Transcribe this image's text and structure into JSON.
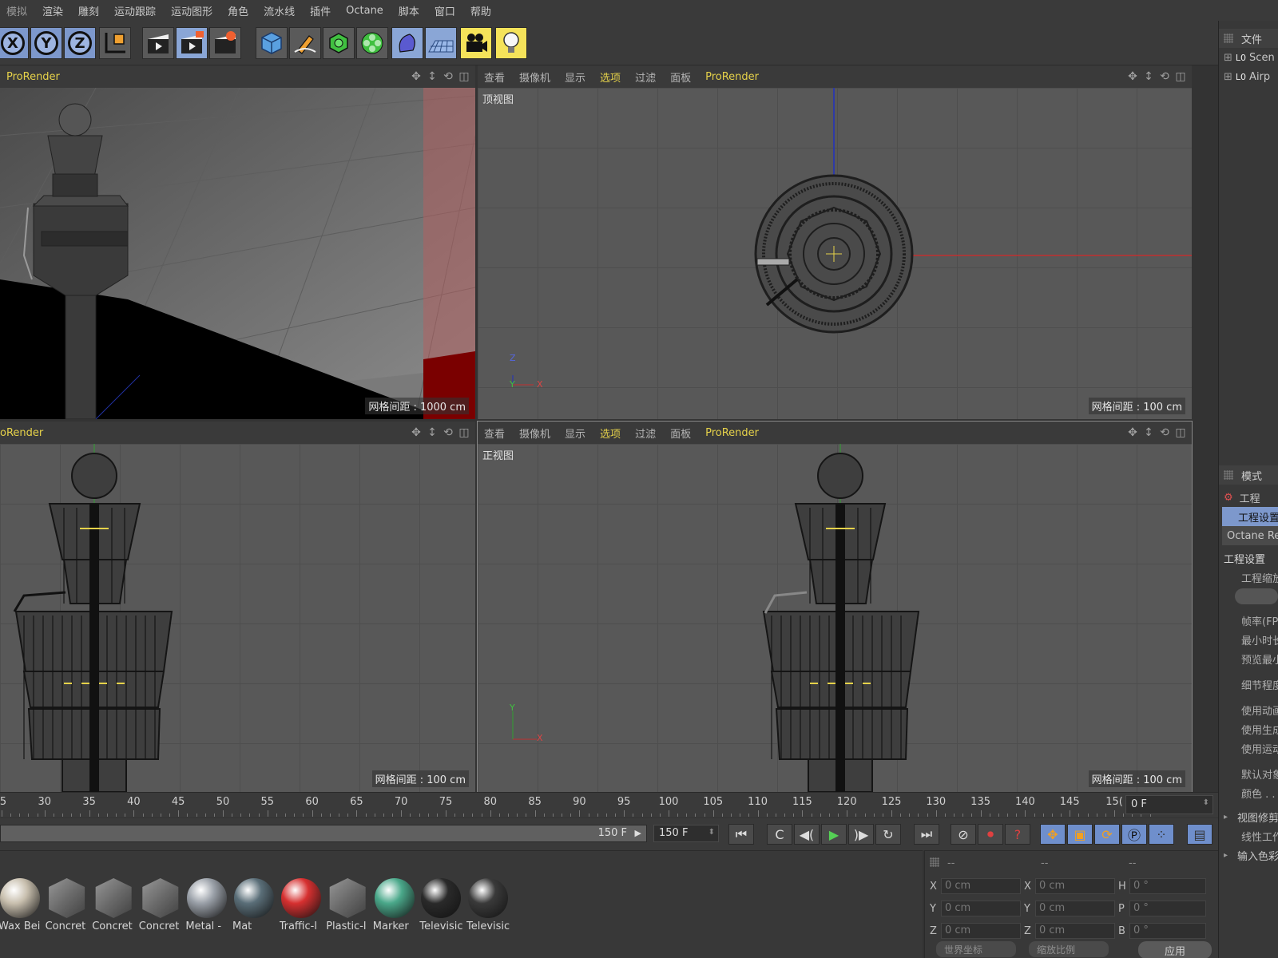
{
  "menubar": {
    "items": [
      "模拟",
      "渲染",
      "雕刻",
      "运动跟踪",
      "运动图形",
      "角色",
      "流水线",
      "插件",
      "Octane",
      "脚本",
      "窗口",
      "帮助"
    ]
  },
  "toolbar": {
    "axis_buttons": [
      "X",
      "Y",
      "Z"
    ],
    "icons": [
      "coordinate-system-icon",
      "render-view-icon",
      "render-picture-viewer-icon",
      "render-settings-icon",
      "cube-icon",
      "pen-icon",
      "subdivision-icon",
      "cloner-icon",
      "deformer-icon",
      "floor-icon",
      "camera-icon",
      "light-icon"
    ]
  },
  "viewports": {
    "perspective": {
      "header_label": "ProRender",
      "grid_spacing": "网格间距 : 1000 cm"
    },
    "top": {
      "menus": [
        "查看",
        "摄像机",
        "显示",
        "选项",
        "过滤",
        "面板",
        "ProRender"
      ],
      "label": "顶视图",
      "grid_spacing": "网格间距 : 100 cm",
      "axis_up": "Z",
      "axis_mid": "Y",
      "axis_right": "X"
    },
    "right": {
      "header_label": "oRender",
      "grid_spacing": "网格间距 : 100 cm"
    },
    "front": {
      "menus": [
        "查看",
        "摄像机",
        "显示",
        "选项",
        "过滤",
        "面板",
        "ProRender"
      ],
      "label": "正视图",
      "grid_spacing": "网格间距 : 100 cm",
      "axis_up": "Y",
      "axis_right": "X"
    }
  },
  "right_panel": {
    "file_tab": "文件",
    "objects": [
      "Scen",
      "Airp"
    ],
    "mode_tab": "模式",
    "project": "工程",
    "tabs": [
      "工程设置",
      "Octane Re"
    ],
    "section": "工程设置",
    "fields": [
      "工程缩放",
      "帧率(FP",
      "最小时长",
      "预览最小",
      "细节程度",
      "使用动画",
      "使用生成",
      "使用运动",
      "默认对象",
      "颜色 . .",
      "视图修剪",
      "线性工作",
      "输入色彩"
    ]
  },
  "timeline": {
    "ticks": [
      "5",
      "30",
      "35",
      "40",
      "45",
      "50",
      "55",
      "60",
      "65",
      "70",
      "75",
      "80",
      "85",
      "90",
      "95",
      "100",
      "105",
      "110",
      "115",
      "120",
      "125",
      "130",
      "135",
      "140",
      "145",
      "15("
    ],
    "current_frame": "0 F",
    "scrub_label": "150 F",
    "max_frame": "150 F"
  },
  "transport": {
    "buttons": [
      "⏮",
      "C",
      "◀(",
      "▶",
      ")▶",
      "↻",
      "⏭"
    ]
  },
  "materials": [
    {
      "name": "Wax Bei",
      "kind": "ball",
      "color": "#c8bfae"
    },
    {
      "name": "Concret",
      "kind": "cube",
      "color": "#8a8a8a"
    },
    {
      "name": "Concret",
      "kind": "cube",
      "color": "#8a8a8a"
    },
    {
      "name": "Concret",
      "kind": "cube",
      "color": "#8a8a8a"
    },
    {
      "name": "Metal -",
      "kind": "ball",
      "color": "#9aa0a8"
    },
    {
      "name": "Mat",
      "kind": "ball",
      "color": "#5a6e78"
    },
    {
      "name": "Traffic-l",
      "kind": "ball",
      "color": "#d63030"
    },
    {
      "name": "Plastic-l",
      "kind": "cube",
      "color": "#bdbdbd"
    },
    {
      "name": "Marker",
      "kind": "ball",
      "color": "#4aa88a"
    },
    {
      "name": "Televisic",
      "kind": "ball",
      "color": "#2a2a2a"
    },
    {
      "name": "Televisic",
      "kind": "ball",
      "color": "#3a3a3a"
    }
  ],
  "coords": {
    "headers": [
      "--",
      "--",
      "--"
    ],
    "rows": [
      {
        "a": "X",
        "av": "0 cm",
        "b": "X",
        "bv": "0 cm",
        "c": "H",
        "cv": "0 °"
      },
      {
        "a": "Y",
        "av": "0 cm",
        "b": "Y",
        "bv": "0 cm",
        "c": "P",
        "cv": "0 °"
      },
      {
        "a": "Z",
        "av": "0 cm",
        "b": "Z",
        "bv": "0 cm",
        "c": "B",
        "cv": "0 °"
      }
    ],
    "world_select": "世界坐标",
    "scale_select": "缩放比例",
    "apply": "应用"
  },
  "colors": {
    "accent_blue": "#7d98cc",
    "yellow": "#e6d24a",
    "grid": "#585858"
  }
}
